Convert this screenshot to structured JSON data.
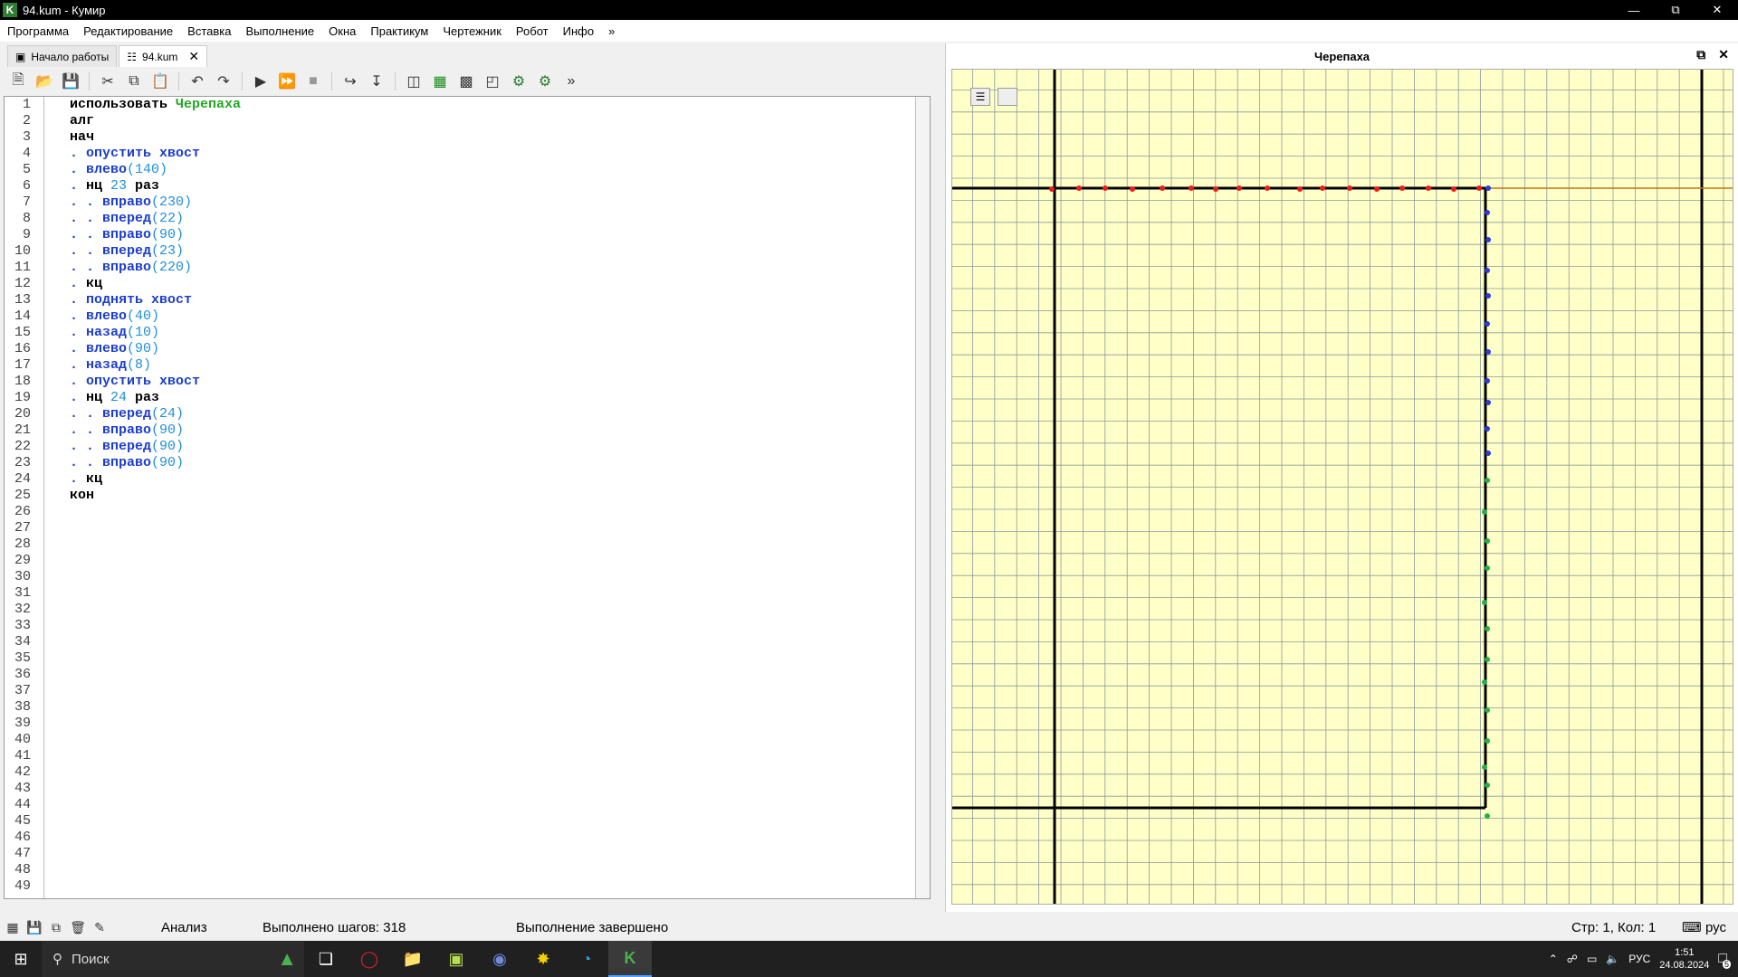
{
  "window": {
    "title": "94.kum - Кумир",
    "app_icon": "K"
  },
  "menu": [
    "Программа",
    "Редактирование",
    "Вставка",
    "Выполнение",
    "Окна",
    "Практикум",
    "Чертежник",
    "Робот",
    "Инфо",
    "»"
  ],
  "tabs": [
    {
      "label": "Начало работы",
      "icon": "page-icon"
    },
    {
      "label": "94.kum",
      "icon": "file-icon",
      "active": true
    }
  ],
  "toolbar_overflow": "»",
  "editor": {
    "line_numbers": [
      "1",
      "2",
      "3",
      "4",
      "5",
      "6",
      "7",
      "8",
      "9",
      "10",
      "11",
      "12",
      "13",
      "14",
      "15",
      "16",
      "17",
      "18",
      "19",
      "20",
      "21",
      "22",
      "23",
      "24",
      "25",
      "26",
      "27",
      "28",
      "29",
      "30",
      "31",
      "32",
      "33",
      "34",
      "35",
      "36",
      "37",
      "38",
      "39",
      "40",
      "41",
      "42",
      "43",
      "44",
      "45",
      "46",
      "47",
      "48",
      "49"
    ],
    "lines": [
      [
        [
          "k",
          "использовать "
        ],
        [
          "m",
          "Черепаха"
        ]
      ],
      [
        [
          "k",
          "алг"
        ]
      ],
      [
        [
          "k",
          "нач"
        ]
      ],
      [
        [
          "d",
          ". "
        ],
        [
          "c",
          "опустить хвост"
        ]
      ],
      [
        [
          "d",
          ". "
        ],
        [
          "c",
          "влево"
        ],
        [
          "n",
          "(140)"
        ]
      ],
      [
        [
          "d",
          ". "
        ],
        [
          "k",
          "нц "
        ],
        [
          "n",
          "23"
        ],
        [
          "k",
          " раз"
        ]
      ],
      [
        [
          "d",
          ". . "
        ],
        [
          "c",
          "вправо"
        ],
        [
          "n",
          "(230)"
        ]
      ],
      [
        [
          "d",
          ". . "
        ],
        [
          "c",
          "вперед"
        ],
        [
          "n",
          "(22)"
        ]
      ],
      [
        [
          "d",
          ". . "
        ],
        [
          "c",
          "вправо"
        ],
        [
          "n",
          "(90)"
        ]
      ],
      [
        [
          "d",
          ". . "
        ],
        [
          "c",
          "вперед"
        ],
        [
          "n",
          "(23)"
        ]
      ],
      [
        [
          "d",
          ". . "
        ],
        [
          "c",
          "вправо"
        ],
        [
          "n",
          "(220)"
        ]
      ],
      [
        [
          "d",
          ". "
        ],
        [
          "k",
          "кц"
        ]
      ],
      [
        [
          "d",
          ". "
        ],
        [
          "c",
          "поднять хвост"
        ]
      ],
      [
        [
          "d",
          ". "
        ],
        [
          "c",
          "влево"
        ],
        [
          "n",
          "(40)"
        ]
      ],
      [
        [
          "d",
          ". "
        ],
        [
          "c",
          "назад"
        ],
        [
          "n",
          "(10)"
        ]
      ],
      [
        [
          "d",
          ". "
        ],
        [
          "c",
          "влево"
        ],
        [
          "n",
          "(90)"
        ]
      ],
      [
        [
          "d",
          ". "
        ],
        [
          "c",
          "назад"
        ],
        [
          "n",
          "(8)"
        ]
      ],
      [
        [
          "d",
          ". "
        ],
        [
          "c",
          "опустить хвост"
        ]
      ],
      [
        [
          "d",
          ". "
        ],
        [
          "k",
          "нц "
        ],
        [
          "n",
          "24"
        ],
        [
          "k",
          " раз"
        ]
      ],
      [
        [
          "d",
          ". . "
        ],
        [
          "c",
          "вперед"
        ],
        [
          "n",
          "(24)"
        ]
      ],
      [
        [
          "d",
          ". . "
        ],
        [
          "c",
          "вправо"
        ],
        [
          "n",
          "(90)"
        ]
      ],
      [
        [
          "d",
          ". . "
        ],
        [
          "c",
          "вперед"
        ],
        [
          "n",
          "(90)"
        ]
      ],
      [
        [
          "d",
          ". . "
        ],
        [
          "c",
          "вправо"
        ],
        [
          "n",
          "(90)"
        ]
      ],
      [
        [
          "d",
          ". "
        ],
        [
          "k",
          "кц"
        ]
      ],
      [
        [
          "k",
          "кон"
        ]
      ]
    ]
  },
  "turtle_panel": {
    "title": "Черепаха"
  },
  "status": {
    "mode": "Анализ",
    "steps": "Выполнено шагов: 318",
    "state": "Выполнение завершено",
    "position": "Стр: 1, Кол: 1",
    "lang": "рус"
  },
  "taskbar": {
    "search_placeholder": "Поиск",
    "lang": "РУС",
    "time": "1:51",
    "date": "24.08.2024",
    "notifications": "5"
  },
  "colors": {
    "grid_bg": "#ffffc8",
    "grid_line": "#8a9a9a",
    "red_marker": "#ee1c1c",
    "blue_marker": "#2d3cd8",
    "green_marker": "#22b04c",
    "orange_line": "#c8701e"
  }
}
